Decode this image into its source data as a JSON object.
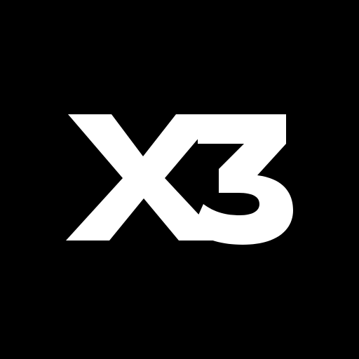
{
  "logo": {
    "text": "X3",
    "foreground_color": "#FFFFFF",
    "background_color": "#000000"
  }
}
